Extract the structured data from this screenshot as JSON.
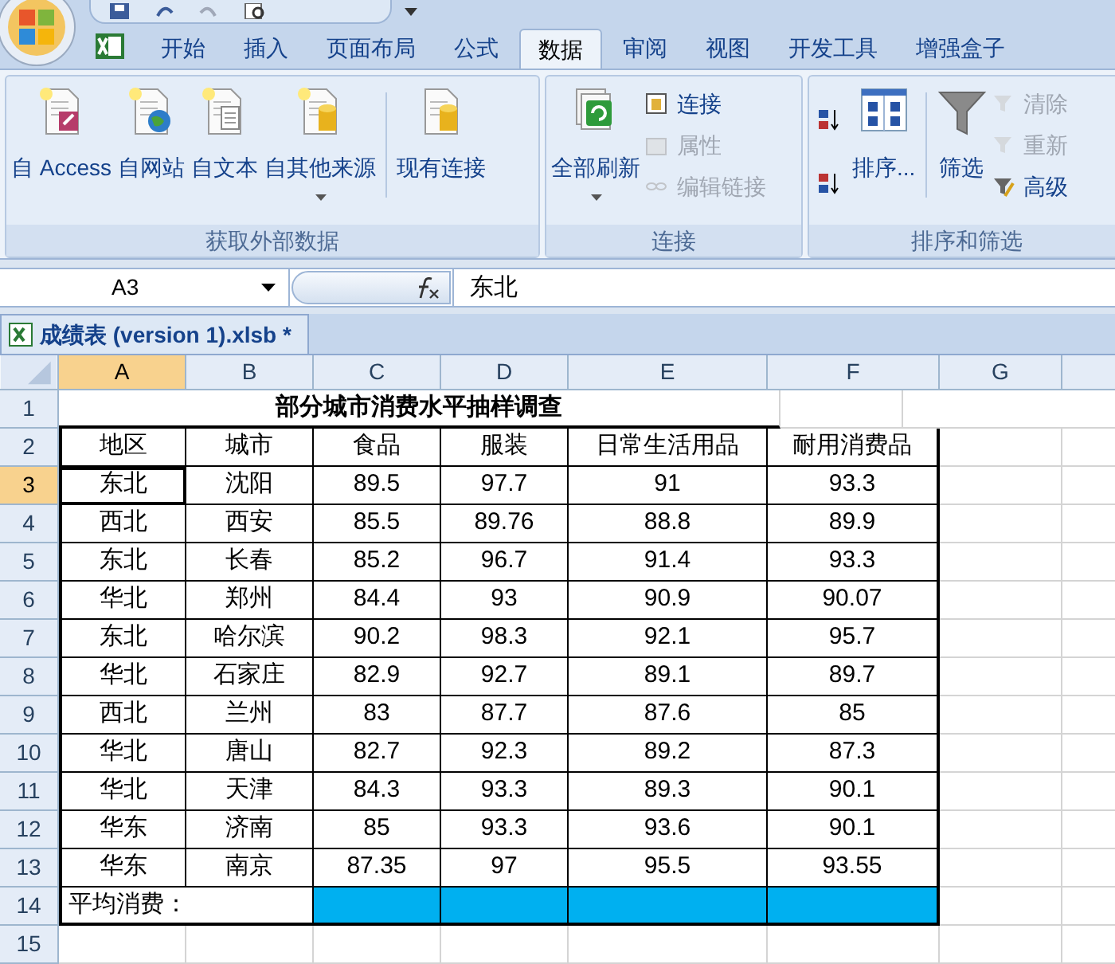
{
  "tabs": [
    {
      "label": "开始",
      "selected": false
    },
    {
      "label": "插入",
      "selected": false
    },
    {
      "label": "页面布局",
      "selected": false
    },
    {
      "label": "公式",
      "selected": false
    },
    {
      "label": "数据",
      "selected": true
    },
    {
      "label": "审阅",
      "selected": false
    },
    {
      "label": "视图",
      "selected": false
    },
    {
      "label": "开发工具",
      "selected": false
    },
    {
      "label": "增强盒子",
      "selected": false
    }
  ],
  "ribbon": {
    "groups": [
      {
        "title": "获取外部数据",
        "items": [
          {
            "kind": "large",
            "label": "自 Access",
            "disabled": false,
            "dropdown": false
          },
          {
            "kind": "large",
            "label": "自网站",
            "disabled": false,
            "dropdown": false
          },
          {
            "kind": "large",
            "label": "自文本",
            "disabled": false,
            "dropdown": false
          },
          {
            "kind": "large",
            "label": "自其他来源",
            "disabled": false,
            "dropdown": true
          },
          {
            "kind": "separator"
          },
          {
            "kind": "large",
            "label": "现有连接",
            "disabled": false,
            "dropdown": false
          }
        ]
      },
      {
        "title": "连接",
        "items": [
          {
            "kind": "large",
            "label": "全部刷新",
            "disabled": false,
            "dropdown": true
          },
          {
            "kind": "stack",
            "items": [
              {
                "label": "连接",
                "disabled": false
              },
              {
                "label": "属性",
                "disabled": true
              },
              {
                "label": "编辑链接",
                "disabled": true
              }
            ]
          }
        ]
      },
      {
        "title": "排序和筛选",
        "items": [
          {
            "kind": "stack",
            "items": [
              {
                "disabled": false
              },
              {
                "disabled": false
              }
            ]
          },
          {
            "kind": "large",
            "label": "排序...",
            "disabled": false,
            "dropdown": false
          },
          {
            "kind": "separator"
          },
          {
            "kind": "large",
            "label": "筛选",
            "disabled": false,
            "dropdown": false
          },
          {
            "kind": "stack",
            "items": [
              {
                "label": "清除",
                "disabled": true
              },
              {
                "label": "重新",
                "disabled": true
              },
              {
                "label": "高级",
                "disabled": false
              }
            ]
          }
        ]
      }
    ]
  },
  "formula_bar": {
    "name_box": "A3",
    "formula": "东北"
  },
  "workbook_tab": {
    "label": "成绩表 (version 1).xlsb *"
  },
  "sheet": {
    "columns": [
      {
        "label": "A",
        "selected": true
      },
      {
        "label": "B",
        "selected": false
      },
      {
        "label": "C",
        "selected": false
      },
      {
        "label": "D",
        "selected": false
      },
      {
        "label": "E",
        "selected": false
      },
      {
        "label": "F",
        "selected": false
      },
      {
        "label": "G",
        "selected": false
      }
    ],
    "rows": [
      {
        "number": "1",
        "kind": "title",
        "selected": false,
        "title": "部分城市消费水平抽样调查"
      },
      {
        "number": "2",
        "kind": "header",
        "selected": false,
        "cells": [
          "地区",
          "城市",
          "食品",
          "服装",
          "日常生活用品",
          "耐用消费品"
        ]
      },
      {
        "number": "3",
        "kind": "data",
        "selected": true,
        "cells": [
          "东北",
          "沈阳",
          "89.5",
          "97.7",
          "91",
          "93.3"
        ]
      },
      {
        "number": "4",
        "kind": "data",
        "selected": false,
        "cells": [
          "西北",
          "西安",
          "85.5",
          "89.76",
          "88.8",
          "89.9"
        ]
      },
      {
        "number": "5",
        "kind": "data",
        "selected": false,
        "cells": [
          "东北",
          "长春",
          "85.2",
          "96.7",
          "91.4",
          "93.3"
        ]
      },
      {
        "number": "6",
        "kind": "data",
        "selected": false,
        "cells": [
          "华北",
          "郑州",
          "84.4",
          "93",
          "90.9",
          "90.07"
        ]
      },
      {
        "number": "7",
        "kind": "data",
        "selected": false,
        "cells": [
          "东北",
          "哈尔滨",
          "90.2",
          "98.3",
          "92.1",
          "95.7"
        ]
      },
      {
        "number": "8",
        "kind": "data",
        "selected": false,
        "cells": [
          "华北",
          "石家庄",
          "82.9",
          "92.7",
          "89.1",
          "89.7"
        ]
      },
      {
        "number": "9",
        "kind": "data",
        "selected": false,
        "cells": [
          "西北",
          "兰州",
          "83",
          "87.7",
          "87.6",
          "85"
        ]
      },
      {
        "number": "10",
        "kind": "data",
        "selected": false,
        "cells": [
          "华北",
          "唐山",
          "82.7",
          "92.3",
          "89.2",
          "87.3"
        ]
      },
      {
        "number": "11",
        "kind": "data",
        "selected": false,
        "cells": [
          "华北",
          "天津",
          "84.3",
          "93.3",
          "89.3",
          "90.1"
        ]
      },
      {
        "number": "12",
        "kind": "data",
        "selected": false,
        "cells": [
          "华东",
          "济南",
          "85",
          "93.3",
          "93.6",
          "90.1"
        ]
      },
      {
        "number": "13",
        "kind": "data",
        "selected": false,
        "cells": [
          "华东",
          "南京",
          "87.35",
          "97",
          "95.5",
          "93.55"
        ]
      },
      {
        "number": "14",
        "kind": "summary",
        "selected": false,
        "label": "平均消费："
      },
      {
        "number": "15",
        "kind": "empty",
        "selected": false
      }
    ]
  }
}
